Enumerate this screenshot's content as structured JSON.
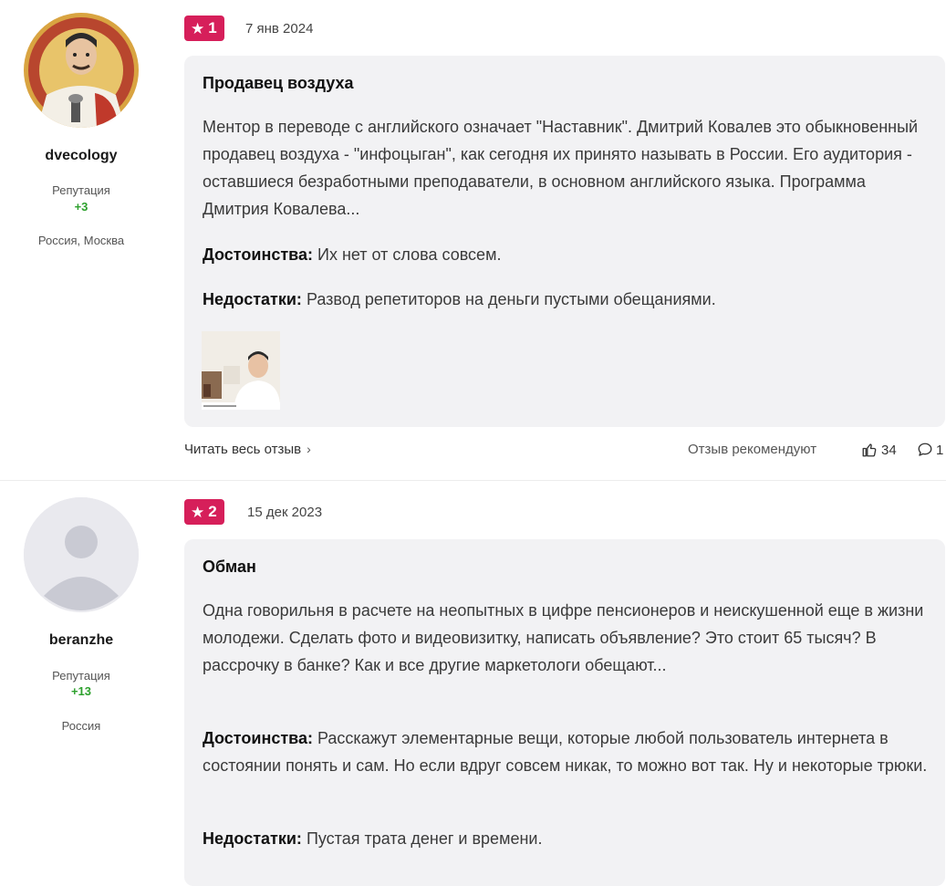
{
  "reviews": [
    {
      "author": {
        "name": "dvecology",
        "reputation_label": "Репутация",
        "reputation_value": "+3",
        "location": "Россия, Москва"
      },
      "rating": "1",
      "date": "7 янв 2024",
      "title": "Продавец воздуха",
      "text": "Ментор в переводе с английского означает \"Наставник\". Дмитрий Ковалев это обыкновенный продавец воздуха - \"инфоцыган\", как сегодня их принято называть в России. Его аудитория - оставшиеся безработными преподаватели, в основном английского языка. Программа Дмитрия Ковалева...",
      "pros_label": "Достоинства:",
      "pros": "Их нет от слова совсем.",
      "cons_label": "Недостатки:",
      "cons": "Развод репетиторов на деньги пустыми обещаниями.",
      "read_more": "Читать весь отзыв",
      "recommend_label": "Отзыв рекомендуют",
      "likes": "34",
      "comments": "1"
    },
    {
      "author": {
        "name": "beranzhe",
        "reputation_label": "Репутация",
        "reputation_value": "+13",
        "location": "Россия"
      },
      "rating": "2",
      "date": "15 дек 2023",
      "title": "Обман",
      "text": "Одна говорильня в расчете на неопытных в цифре пенсионеров и неискушенной еще в жизни молодежи. Сделать фото и видеовизитку, написать объявление? Это стоит 65 тысяч? В рассрочку в банке? Как и все другие маркетологи обещают...",
      "pros_label": "Достоинства:",
      "pros": "Расскажут элементарные вещи, которые любой пользователь интернета в состоянии понять и сам. Но если вдруг совсем никак, то можно вот так. Ну и некоторые трюки.",
      "cons_label": "Недостатки:",
      "cons": "Пустая трата денег и времени."
    }
  ],
  "colors": {
    "badge": "#d61f5a",
    "card_bg": "#f2f2f4",
    "reputation": "#2ca02c"
  }
}
